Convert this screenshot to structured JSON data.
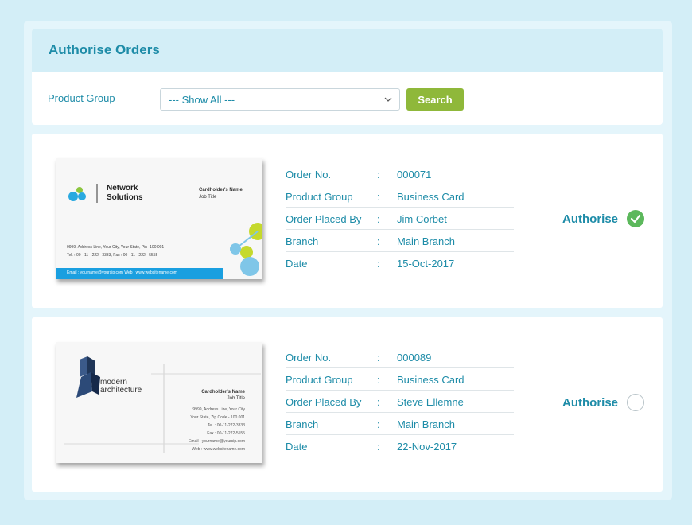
{
  "header": {
    "title": "Authorise Orders"
  },
  "filter": {
    "label": "Product Group",
    "select_value": "--- Show All ---",
    "search_label": "Search"
  },
  "colors": {
    "accent": "#1e8ca8",
    "button": "#8fb83a",
    "check_on": "#5cb85c",
    "page_bg": "#d3eef7"
  },
  "field_labels": {
    "order_no": "Order No.",
    "product_group": "Product Group",
    "placed_by": "Order Placed By",
    "branch": "Branch",
    "date": "Date",
    "colon": ":"
  },
  "orders": [
    {
      "order_no": "000071",
      "product_group": "Business Card",
      "placed_by": "Jim Corbet",
      "branch": "Main Branch",
      "date": "15-Oct-2017",
      "authorise_label": "Authorise",
      "authorised": true,
      "card": {
        "company_line1": "Network",
        "company_line2": "Solutions",
        "name": "Cardholder's Name",
        "job": "Job Title",
        "address1": "9999, Address Line, Your City, Your State, Pin -100 001",
        "address2": "Tel. : 00 - 11 - 222 - 3333, Fax : 00 - 11 - 222 - 5555",
        "footer": "Email : yourname@yoursip.com    Web : www.websitename.com"
      }
    },
    {
      "order_no": "000089",
      "product_group": "Business Card",
      "placed_by": "Steve Ellemne",
      "branch": "Main Branch",
      "date": "22-Nov-2017",
      "authorise_label": "Authorise",
      "authorised": false,
      "card": {
        "company_line1": "modern",
        "company_line2": "architecture",
        "name": "Cardholder's Name",
        "job": "Job Title",
        "lines": [
          "9999, Address Line, Your City",
          "Your State, Zip Code - 100 001",
          "Tel. : 00-11-222-3333",
          "Fax : 00-11-222-5555",
          "Email : yourname@yoursip.com",
          "Web : www.websitename.com"
        ]
      }
    }
  ]
}
